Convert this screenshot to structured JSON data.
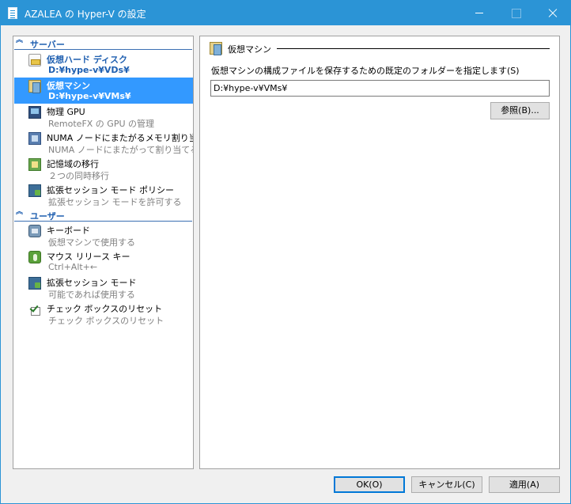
{
  "window": {
    "title": "AZALEA の Hyper-V の設定"
  },
  "sidebar": {
    "sections": [
      {
        "label": "サーバー",
        "items": [
          {
            "name": "仮想ハード ディスク",
            "sub": "D:¥hype-v¥VDs¥",
            "icon": "disk-icon"
          },
          {
            "name": "仮想マシン",
            "sub": "D:¥hype-v¥VMs¥",
            "icon": "vm-icon",
            "selected": true
          },
          {
            "name": "物理 GPU",
            "sub": "RemoteFX の GPU の管理",
            "icon": "monitor-icon"
          },
          {
            "name": "NUMA ノードにまたがるメモリ割り当て",
            "sub": "NUMA ノードにまたがって割り当てる",
            "icon": "numa-icon"
          },
          {
            "name": "記憶域の移行",
            "sub": "２つの同時移行",
            "icon": "migration-icon"
          },
          {
            "name": "拡張セッション モード ポリシー",
            "sub": "拡張セッション モードを許可する",
            "icon": "session-icon"
          }
        ]
      },
      {
        "label": "ユーザー",
        "items": [
          {
            "name": "キーボード",
            "sub": "仮想マシンで使用する",
            "icon": "keyboard-icon"
          },
          {
            "name": "マウス リリース キー",
            "sub": "Ctrl+Alt+←",
            "icon": "mouse-icon"
          },
          {
            "name": "拡張セッション モード",
            "sub": "可能であれば使用する",
            "icon": "session-icon"
          },
          {
            "name": "チェック ボックスのリセット",
            "sub": "チェック ボックスのリセット",
            "icon": "checkbox-icon"
          }
        ]
      }
    ]
  },
  "panel": {
    "title": "仮想マシン",
    "description": "仮想マシンの構成ファイルを保存するための既定のフォルダーを指定します(S)",
    "folder_value": "D:¥hype-v¥VMs¥",
    "browse_label": "参照(B)..."
  },
  "buttons": {
    "ok": "OK(O)",
    "cancel": "キャンセル(C)",
    "apply": "適用(A)"
  },
  "colors": {
    "titlebar": "#2b94d6",
    "selection": "#3399ff",
    "section_header": "#1f5fb0"
  }
}
